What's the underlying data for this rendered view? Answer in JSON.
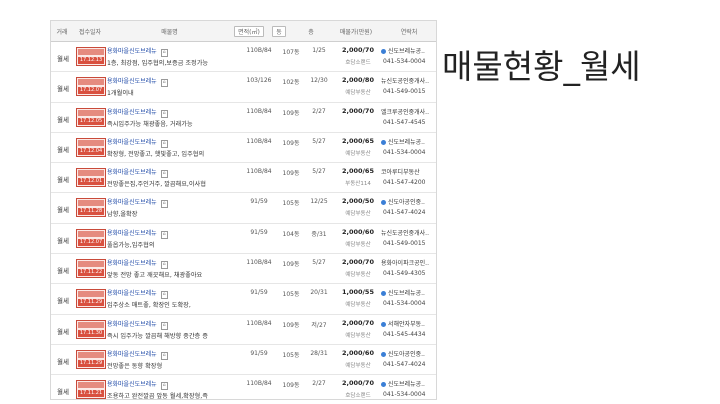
{
  "page_title": "매물현황_월세",
  "columns": [
    "거래",
    "접수일자",
    "매물명",
    "면적(㎡)",
    "동",
    "층",
    "매물가(만원)",
    "연락처"
  ],
  "sort_options": {
    "area": "면적(㎡)",
    "dong": "동"
  },
  "rows": [
    {
      "type": "월세",
      "date": "17.12.13",
      "title": "용화마을신도브레뉴",
      "desc": "1층, 최강점, 입주협의,보증금 조정가능",
      "area": "110B/84",
      "dong": "107동",
      "floor": "1/25",
      "price": "2,000/70",
      "source": "호담소랜드",
      "office": "신도브레뉴공..",
      "phone": "041-534-0004",
      "badge": true
    },
    {
      "type": "월세",
      "date": "17.12.07",
      "title": "용화마을신도브레뉴",
      "desc": "1개월이내",
      "area": "103/126",
      "dong": "102동",
      "floor": "12/30",
      "price": "2,000/80",
      "source": "예담부동산",
      "office": "뉴신도공인중개사..",
      "phone": "041-549-0015",
      "badge": false
    },
    {
      "type": "월세",
      "date": "17.12.05",
      "title": "용화마을신도브레뉴",
      "desc": "즉시입주가능 채광좋음, 거래가능",
      "area": "110B/84",
      "dong": "109동",
      "floor": "2/27",
      "price": "2,000/70",
      "source": "",
      "office": "엘크루공인중개사..",
      "phone": "041-547-4545",
      "badge": false
    },
    {
      "type": "월세",
      "date": "17.12.04",
      "title": "용화마을신도브레뉴",
      "desc": "확장형, 전망좋고, 햇빛좋고, 입주협의",
      "area": "110B/84",
      "dong": "109동",
      "floor": "5/27",
      "price": "2,000/65",
      "source": "예담부동산",
      "office": "신도브레뉴공..",
      "phone": "041-534-0004",
      "badge": true
    },
    {
      "type": "월세",
      "date": "17.12.01",
      "title": "용화마을신도브레뉴",
      "desc": "전망좋은집,주인거주, 깔끔해요,이사협",
      "area": "110B/84",
      "dong": "109동",
      "floor": "5/27",
      "price": "2,000/65",
      "source": "부동산114",
      "office": "코아루디부동산",
      "phone": "041-547-4200",
      "badge": false
    },
    {
      "type": "월세",
      "date": "17.11.28",
      "title": "용화마을신도브레뉴",
      "desc": "남향,올확장",
      "area": "91/59",
      "dong": "105동",
      "floor": "12/25",
      "price": "2,000/50",
      "source": "예담부동산",
      "office": "신도아공인중..",
      "phone": "041-547-4024",
      "badge": true
    },
    {
      "type": "월세",
      "date": "17.12.07",
      "title": "용화마을신도브레뉴",
      "desc": "풀옵가능,입주협의",
      "area": "91/59",
      "dong": "104동",
      "floor": "중/31",
      "price": "2,000/60",
      "source": "예담부동산",
      "office": "뉴신도공인중개사..",
      "phone": "041-549-0015",
      "badge": false
    },
    {
      "type": "월세",
      "date": "17.11.22",
      "title": "용화마을신도브레뉴",
      "desc": "앞동 전망 좋고 깨끗해요, 채광좋아요",
      "area": "110B/84",
      "dong": "109동",
      "floor": "5/27",
      "price": "2,000/70",
      "source": "예담부동산",
      "office": "용화아이파크공인..",
      "phone": "041-549-4305",
      "badge": false
    },
    {
      "type": "월세",
      "date": "17.11.29",
      "title": "용화마을신도브레뉴",
      "desc": "입주상소 매트좋, 확장인 도확장,",
      "area": "91/59",
      "dong": "105동",
      "floor": "20/31",
      "price": "1,000/55",
      "source": "예담부동산",
      "office": "신도브레뉴공..",
      "phone": "041-534-0004",
      "badge": true
    },
    {
      "type": "월세",
      "date": "17.11.30",
      "title": "용화마을신도브레뉴",
      "desc": "즉시 입주가능 깔끔해 해방향 중간층 증",
      "area": "110B/84",
      "dong": "109동",
      "floor": "저/27",
      "price": "2,000/70",
      "source": "예담부동산",
      "office": "서해안자부동..",
      "phone": "041-545-4434",
      "badge": true
    },
    {
      "type": "월세",
      "date": "17.11.29",
      "title": "용화마을신도브레뉴",
      "desc": "전망좋은 동향 확장형",
      "area": "91/59",
      "dong": "105동",
      "floor": "28/31",
      "price": "2,000/60",
      "source": "예담부동산",
      "office": "신도아공인중..",
      "phone": "041-547-4024",
      "badge": true
    },
    {
      "type": "월세",
      "date": "17.11.21",
      "title": "용화마을신도브레뉴",
      "desc": "조용하고 완전깔끔 앞동 월세,확장형,즉",
      "area": "110B/84",
      "dong": "109동",
      "floor": "2/27",
      "price": "2,000/70",
      "source": "호담소랜드",
      "office": "신도브레뉴공..",
      "phone": "041-534-0004",
      "badge": true
    }
  ]
}
